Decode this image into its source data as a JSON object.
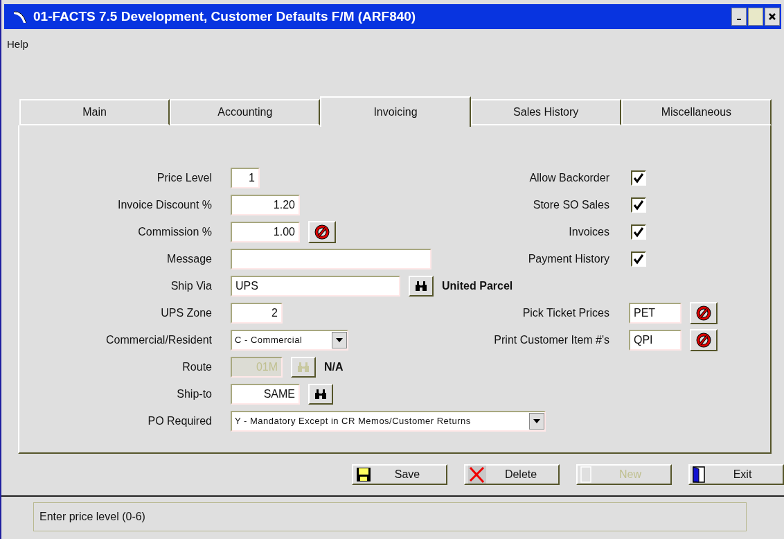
{
  "window": {
    "title": "01-FACTS 7.5 Development, Customer Defaults F/M (ARF840)"
  },
  "menu": [
    "Help"
  ],
  "tabs": [
    {
      "label": "Main",
      "selected": false
    },
    {
      "label": "Accounting",
      "selected": false
    },
    {
      "label": "Invoicing",
      "selected": true
    },
    {
      "label": "Sales History",
      "selected": false
    },
    {
      "label": "Miscellaneous",
      "selected": false
    }
  ],
  "left_fields": [
    {
      "label": "Price Level",
      "kind": "text",
      "value": "1"
    },
    {
      "label": "Invoice Discount %",
      "kind": "text",
      "value": "1.20"
    },
    {
      "label": "Commission %",
      "kind": "text",
      "value": "1.00",
      "clear_button": true
    },
    {
      "label": "Message",
      "kind": "text"
    },
    {
      "label": "Ship Via",
      "kind": "text",
      "value": "UPS",
      "lookup": true,
      "description": "United Parcel"
    },
    {
      "label": "UPS Zone",
      "kind": "text",
      "value": "2"
    },
    {
      "label": "Commercial/Resident",
      "kind": "select",
      "value": "C - Commercial"
    },
    {
      "label": "Route",
      "kind": "text",
      "value": "01M",
      "disabled": true,
      "lookup": true,
      "description": "N/A"
    },
    {
      "label": "Ship-to",
      "kind": "text",
      "value": "SAME",
      "lookup": true
    },
    {
      "label": "PO Required",
      "kind": "select",
      "value": "Y - Mandatory Except in CR Memos/Customer Returns"
    }
  ],
  "right_fields": [
    {
      "label": "Allow Backorder",
      "kind": "checkbox",
      "checked": true
    },
    {
      "label": "Store SO Sales",
      "kind": "checkbox",
      "checked": true
    },
    {
      "label": "Invoices",
      "kind": "checkbox",
      "checked": true
    },
    {
      "label": "Payment History",
      "kind": "checkbox",
      "checked": true
    },
    {
      "label": "Pick Ticket Prices",
      "kind": "code",
      "value": "PET"
    },
    {
      "label": "Print Customer Item #'s",
      "kind": "code",
      "value": "QPI"
    }
  ],
  "buttons": [
    {
      "label": "Save",
      "kind": "save",
      "disabled": false
    },
    {
      "label": "Delete",
      "kind": "delete",
      "disabled": false
    },
    {
      "label": "New",
      "kind": "new",
      "disabled": true
    },
    {
      "label": "Exit",
      "kind": "exit",
      "disabled": false
    }
  ],
  "status_bar": "Enter price level (0-6)"
}
